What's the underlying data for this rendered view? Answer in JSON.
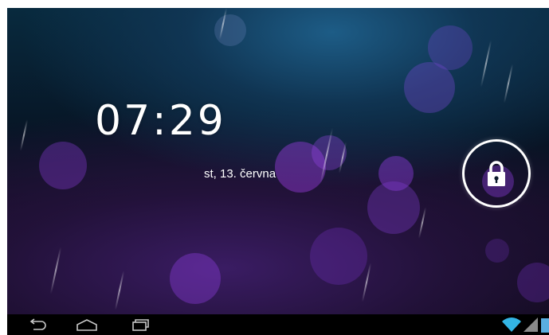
{
  "lockscreen": {
    "time": "07:29",
    "date": "st, 13. června"
  },
  "icons": {
    "unlock": "padlock-icon",
    "back": "back-icon",
    "home": "home-icon",
    "recents": "recent-apps-icon",
    "wifi": "wifi-icon",
    "signal": "signal-icon",
    "battery": "battery-icon"
  },
  "colors": {
    "accent_wifi": "#33b5e5",
    "nav_icon": "#c8c8c8"
  }
}
